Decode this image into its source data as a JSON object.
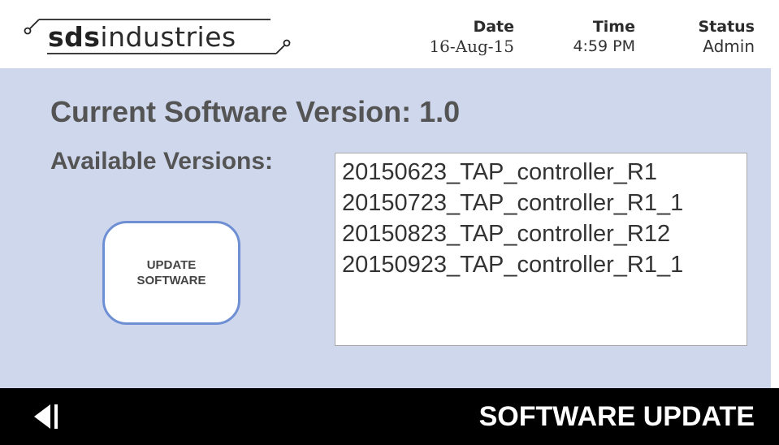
{
  "header": {
    "logo": {
      "bold": "sds",
      "light": "industries"
    },
    "date_label": "Date",
    "date_value": "16-Aug-15",
    "time_label": "Time",
    "time_value": "4:59 PM",
    "status_label": "Status",
    "status_value": "Admin"
  },
  "main": {
    "current_version_text": "Current Software Version: 1.0",
    "available_versions_label": "Available Versions:",
    "versions": [
      "20150623_TAP_controller_R1",
      "20150723_TAP_controller_R1_1",
      "20150823_TAP_controller_R12",
      "20150923_TAP_controller_R1_1"
    ],
    "update_button": {
      "line1": "UPDATE",
      "line2": "SOFTWARE"
    }
  },
  "footer": {
    "title": "SOFTWARE UPDATE",
    "back_icon": "back-arrow-icon"
  },
  "colors": {
    "panel_background": "#cfd7ec",
    "button_border": "#6f8fd4",
    "footer_background": "#000000",
    "text_dark": "#545454"
  }
}
